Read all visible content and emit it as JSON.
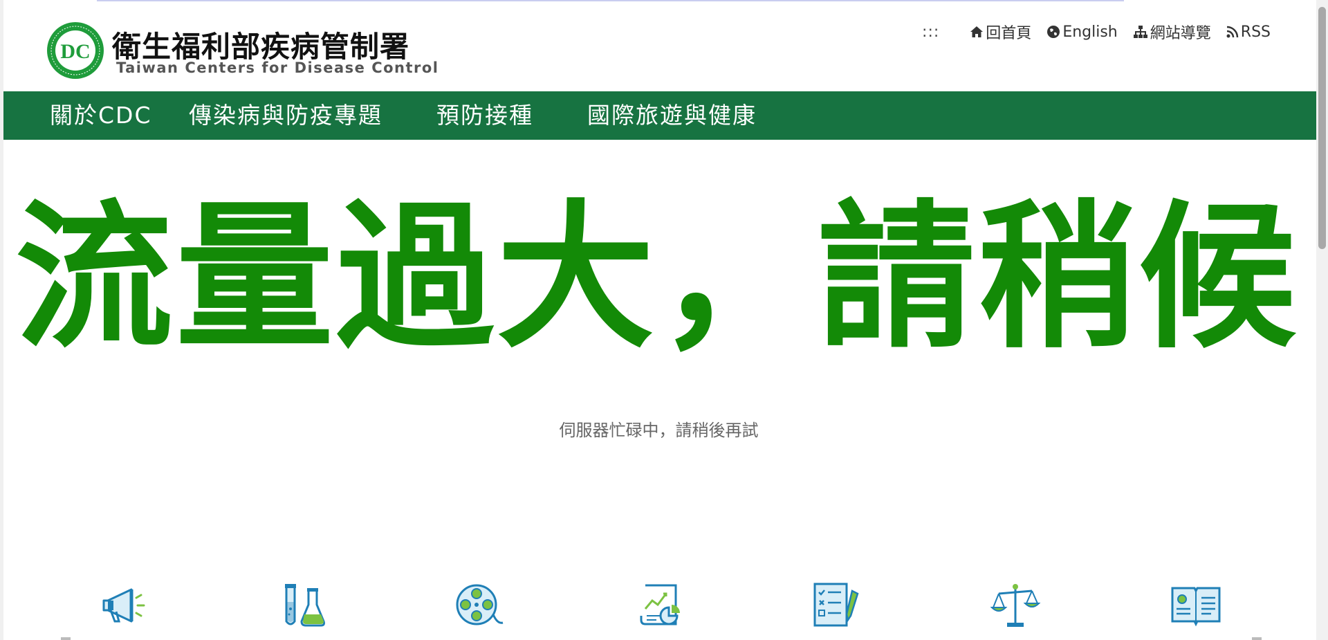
{
  "header": {
    "brand_zh": "衛生福利部疾病管制署",
    "brand_en": "Taiwan Centers for Disease Control",
    "logo_text": "DC",
    "logo_ring_text": "衛生福利部疾病管制署 Centers for Disease Control"
  },
  "utility_nav": {
    "accesskey": ":::",
    "home": "回首頁",
    "english": "English",
    "sitemap": "網站導覽",
    "rss": "RSS"
  },
  "main_nav": {
    "items": [
      {
        "label": "關於CDC"
      },
      {
        "label": "傳染病與防疫專題"
      },
      {
        "label": "預防接種"
      },
      {
        "label": "國際旅遊與健康"
      }
    ]
  },
  "notice": {
    "headline": "流量過大，請稍候",
    "subtext": "伺服器忙碌中，請稍後再試"
  },
  "icons": [
    {
      "name": "megaphone-icon"
    },
    {
      "name": "test-tube-flask-icon"
    },
    {
      "name": "film-reel-icon"
    },
    {
      "name": "report-chart-icon"
    },
    {
      "name": "checklist-pen-icon"
    },
    {
      "name": "balance-scale-icon"
    },
    {
      "name": "open-book-icon"
    }
  ],
  "colors": {
    "nav_bg": "#177341",
    "headline": "#138a07",
    "icon_blue": "#1f7fb6",
    "icon_green": "#7cc242",
    "logo_green": "#1f9c3b"
  }
}
